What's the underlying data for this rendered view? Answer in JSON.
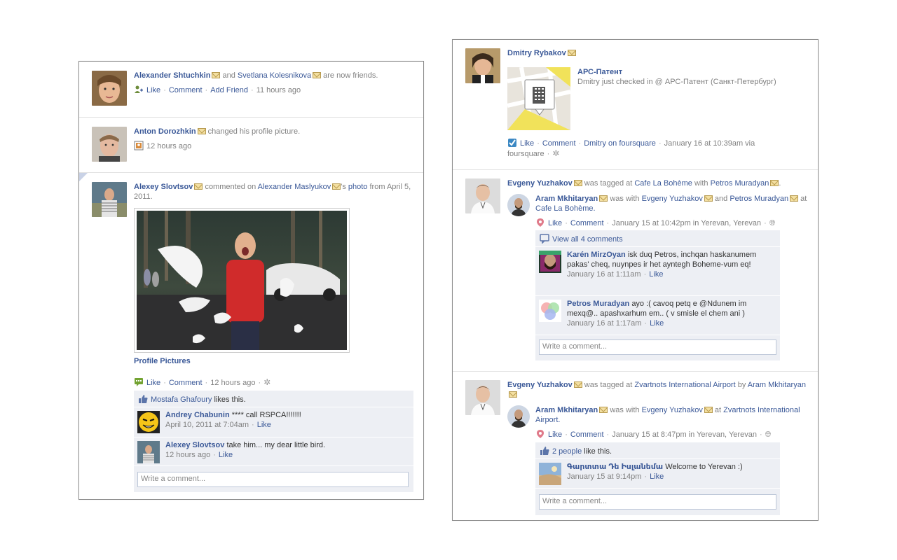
{
  "left": {
    "story1": {
      "actor": "Alexander Shtuchkin",
      "and_text": "and",
      "friend": "Svetlana Kolesnikova",
      "action": "are now friends.",
      "like": "Like",
      "comment": "Comment",
      "add_friend": "Add Friend",
      "time": "11 hours ago"
    },
    "story2": {
      "actor": "Anton Dorozhkin",
      "action": "changed his profile picture.",
      "time": "12 hours ago"
    },
    "story3": {
      "actor": "Alexey Slovtsov",
      "action": "commented on",
      "target": "Alexander Maslyukov",
      "possessive": "'s",
      "photo": "photo",
      "from_text": "from",
      "date": "April 5, 2011.",
      "album": "Profile Pictures",
      "like": "Like",
      "comment": "Comment",
      "time": "12 hours ago",
      "likes_name": "Mostafa Ghafoury",
      "likes_text": "likes this.",
      "comments": [
        {
          "author": "Andrey Chabunin",
          "text": "**** call RSPCA!!!!!!!",
          "time": "April 10, 2011 at 7:04am",
          "like": "Like"
        },
        {
          "author": "Alexey Slovtsov",
          "text": "take him... my dear little bird.",
          "time": "12 hours ago",
          "like": "Like"
        }
      ],
      "write_placeholder": "Write a comment..."
    }
  },
  "right": {
    "story1": {
      "actor": "Dmitry Rybakov",
      "place": "АРС-Патент",
      "checkin_text": "Dmitry just checked in @ АРС-Патент (Санкт-Петербург)",
      "like": "Like",
      "comment": "Comment",
      "foursquare_link": "Dmitry on foursquare",
      "time": "January 16 at 10:39am via",
      "via": "foursquare"
    },
    "story2": {
      "actor": "Evgeny Yuzhakov",
      "tagged_text": "was tagged at",
      "place": "Cafe La Bohème",
      "with_text": "with",
      "with_name": "Petros Muradyan",
      "period": ".",
      "sub_actor": "Aram Mkhitaryan",
      "sub_was_with": "was with",
      "sub_name1": "Evgeny Yuzhakov",
      "sub_and": "and",
      "sub_name2": "Petros Muradyan",
      "sub_at": "at",
      "sub_place": "Cafe La Bohème.",
      "like": "Like",
      "comment": "Comment",
      "time": "January 15 at 10:42pm in Yerevan, Yerevan",
      "view_all": "View all 4 comments",
      "comments": [
        {
          "author": "Karén MirzOyan",
          "text": "isk duq Petros, inchqan haskanumem pakas' cheq, nuynpes ir het ayntegh Boheme-vum eq!",
          "time": "January 16 at 1:11am",
          "like": "Like"
        },
        {
          "author": "Petros Muradyan",
          "text": "ayo :( cavoq petq e @Ndunem im mexq@.. apashxarhum em.. ( v smisle el chem ani )",
          "time": "January 16 at 1:17am",
          "like": "Like"
        }
      ],
      "write_placeholder": "Write a comment..."
    },
    "story3": {
      "actor": "Evgeny Yuzhakov",
      "tagged_text": "was tagged at",
      "place": "Zvartnots International Airport",
      "by_text": "by",
      "by_name": "Aram Mkhitaryan",
      "sub_actor": "Aram Mkhitaryan",
      "sub_was_with": "was with",
      "sub_name1": "Evgeny Yuzhakov",
      "sub_at": "at",
      "sub_place": "Zvartnots International Airport.",
      "like": "Like",
      "comment": "Comment",
      "time": "January 15 at 8:47pm in Yerevan, Yerevan",
      "likes_count": "2 people",
      "likes_text": "like this.",
      "comments": [
        {
          "author": "Գարտտա Դե Իսլանեմա",
          "text": "Welcome to Yerevan :)",
          "time": "January 15 at 9:14pm",
          "like": "Like"
        }
      ],
      "write_placeholder": "Write a comment..."
    }
  },
  "colors": {
    "link": "#3b5998",
    "meta": "#808080",
    "ufi_bg": "#edeff4",
    "border": "#8a8a8a"
  },
  "icons": [
    "friend-add-icon",
    "profile-picture-icon",
    "comment-bubble-icon",
    "thumbs-up-icon",
    "gear-icon",
    "envelope-icon",
    "foursquare-icon",
    "place-pin-icon",
    "globe-icon",
    "building-icon"
  ]
}
